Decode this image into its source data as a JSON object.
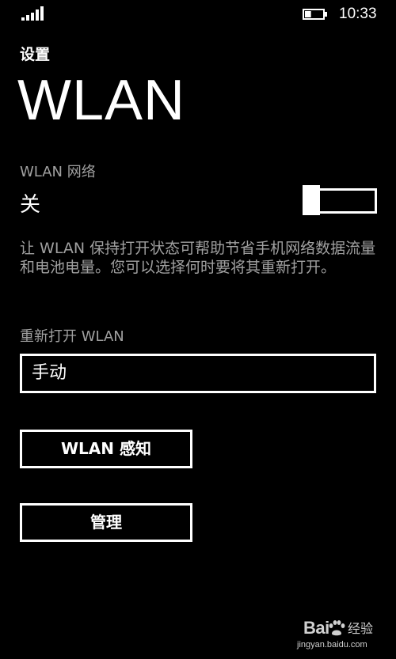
{
  "status_bar": {
    "time": "10:33",
    "signal_icon": "signal-strength-icon",
    "battery_icon": "battery-icon",
    "battery_level": 0.35
  },
  "header": {
    "app_title": "设置",
    "page_title": "WLAN"
  },
  "wlan_network": {
    "label": "WLAN 网络",
    "state": "关",
    "enabled": false
  },
  "description": "让 WLAN 保持打开状态可帮助节省手机网络数据流量和电池电量。您可以选择何时要将其重新打开。",
  "reopen": {
    "label": "重新打开 WLAN",
    "selected": "手动"
  },
  "buttons": {
    "wlan_sense": "WLAN 感知",
    "manage": "管理"
  },
  "watermark": {
    "logo_text": "Bai",
    "logo_suffix": "经验",
    "url": "jingyan.baidu.com"
  }
}
